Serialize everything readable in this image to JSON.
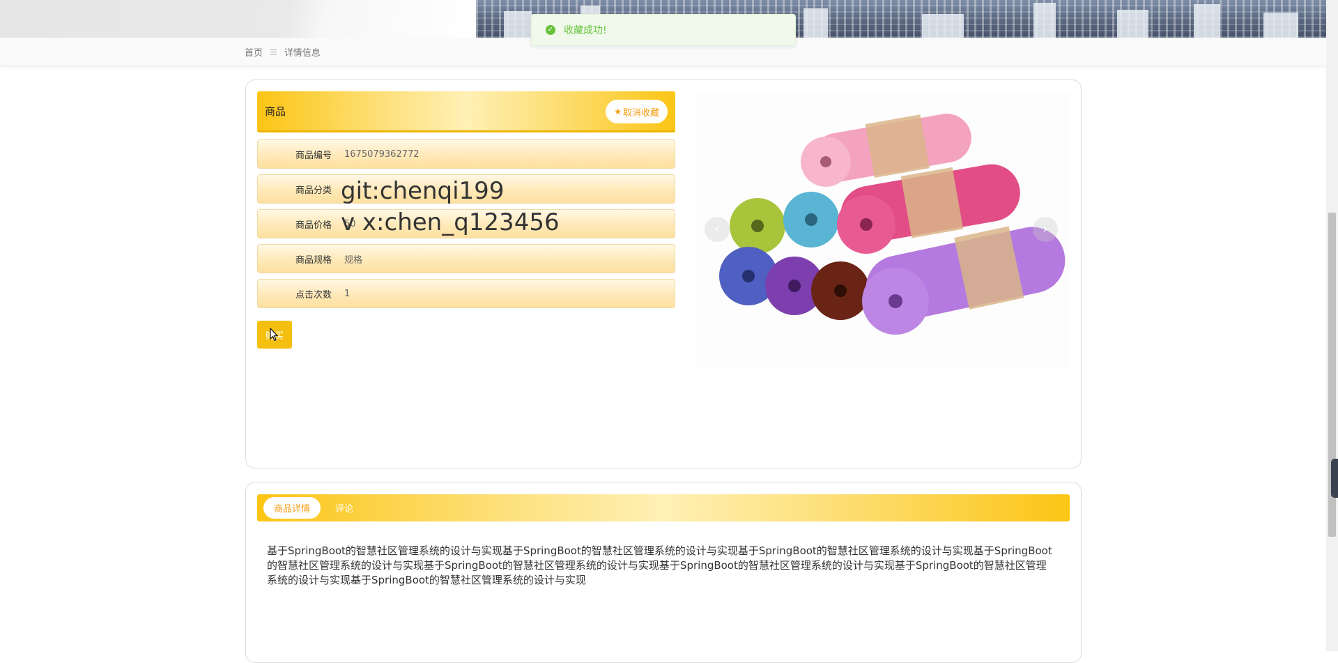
{
  "toast": {
    "icon": "check-circle-icon",
    "message": "收藏成功!"
  },
  "breadcrumb": {
    "home": "首页",
    "separator": "☰",
    "current": "详情信息"
  },
  "product": {
    "title": "商品",
    "favorite_button": "取消收藏",
    "fields": [
      {
        "label": "商品编号",
        "value": "1675079362772"
      },
      {
        "label": "商品分类",
        "value": ""
      },
      {
        "label": "商品价格",
        "value": "50"
      },
      {
        "label": "商品规格",
        "value": "规格"
      },
      {
        "label": "点击次数",
        "value": "1"
      }
    ],
    "buy_button": "购买"
  },
  "watermark": {
    "line1": "git:chenqi199",
    "line2": "v x:chen_q123456"
  },
  "carousel": {
    "prev": "‹",
    "next": "›",
    "image": "yoga-mats-photo"
  },
  "tabs": [
    {
      "label": "商品详情",
      "active": true
    },
    {
      "label": "评论",
      "active": false
    }
  ],
  "description": "基于SpringBoot的智慧社区管理系统的设计与实现基于SpringBoot的智慧社区管理系统的设计与实现基于SpringBoot的智慧社区管理系统的设计与实现基于SpringBoot的智慧社区管理系统的设计与实现基于SpringBoot的智慧社区管理系统的设计与实现基于SpringBoot的智慧社区管理系统的设计与实现基于SpringBoot的智慧社区管理系统的设计与实现基于SpringBoot的智慧社区管理系统的设计与实现",
  "colors": {
    "accent": "#fcc515",
    "success": "#67c23a",
    "favorite": "#f39c12"
  }
}
